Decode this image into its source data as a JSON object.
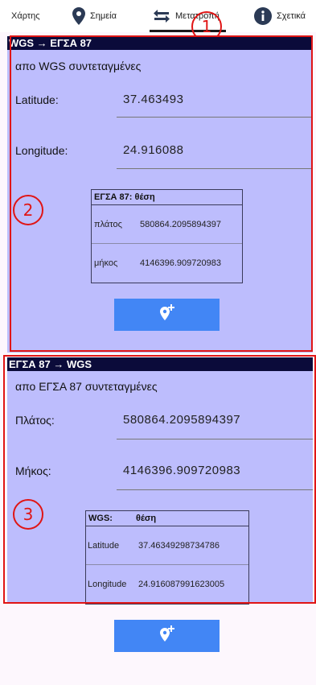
{
  "tabs": [
    {
      "label": "Χάρτης",
      "icon": "map-icon"
    },
    {
      "label": "Σημεία",
      "icon": "location-pin-icon"
    },
    {
      "label": "Μετατροπή",
      "icon": "swap-arrows-icon"
    },
    {
      "label": "Σχετικά",
      "icon": "info-icon"
    }
  ],
  "annotations": [
    "1",
    "2",
    "3"
  ],
  "wgs_to_egsa": {
    "header": "WGS → ΕΓΣΑ 87",
    "subtitle": "απο WGS συντεταγμένες",
    "lat_label": "Latitude:",
    "lat_value": "37.463493",
    "lon_label": "Longitude:",
    "lon_value": "24.916088",
    "result": {
      "header": "ΕΓΣΑ 87: θέση",
      "rows": [
        {
          "label": "πλάτος",
          "value": "580864.2095894397"
        },
        {
          "label": "μήκος",
          "value": "4146396.909720983"
        }
      ]
    }
  },
  "egsa_to_wgs": {
    "header": "ΕΓΣΑ 87 → WGS",
    "subtitle": "απο ΕΓΣΑ 87 συντεταγμένες",
    "x_label": "Πλάτος:",
    "x_value": "580864.2095894397",
    "y_label": "Μήκος:",
    "y_value": "4146396.909720983",
    "result": {
      "header_left": "WGS:",
      "header_right": "θέση",
      "rows": [
        {
          "label": "Latitude",
          "value": "37.46349298734786"
        },
        {
          "label": "Longitude",
          "value": "24.916087991623005"
        }
      ]
    }
  },
  "colors": {
    "section_bg": "#bdbdfd",
    "header_bg": "#0b0b3a",
    "button_bg": "#4286f5",
    "annotation": "#e01515"
  }
}
